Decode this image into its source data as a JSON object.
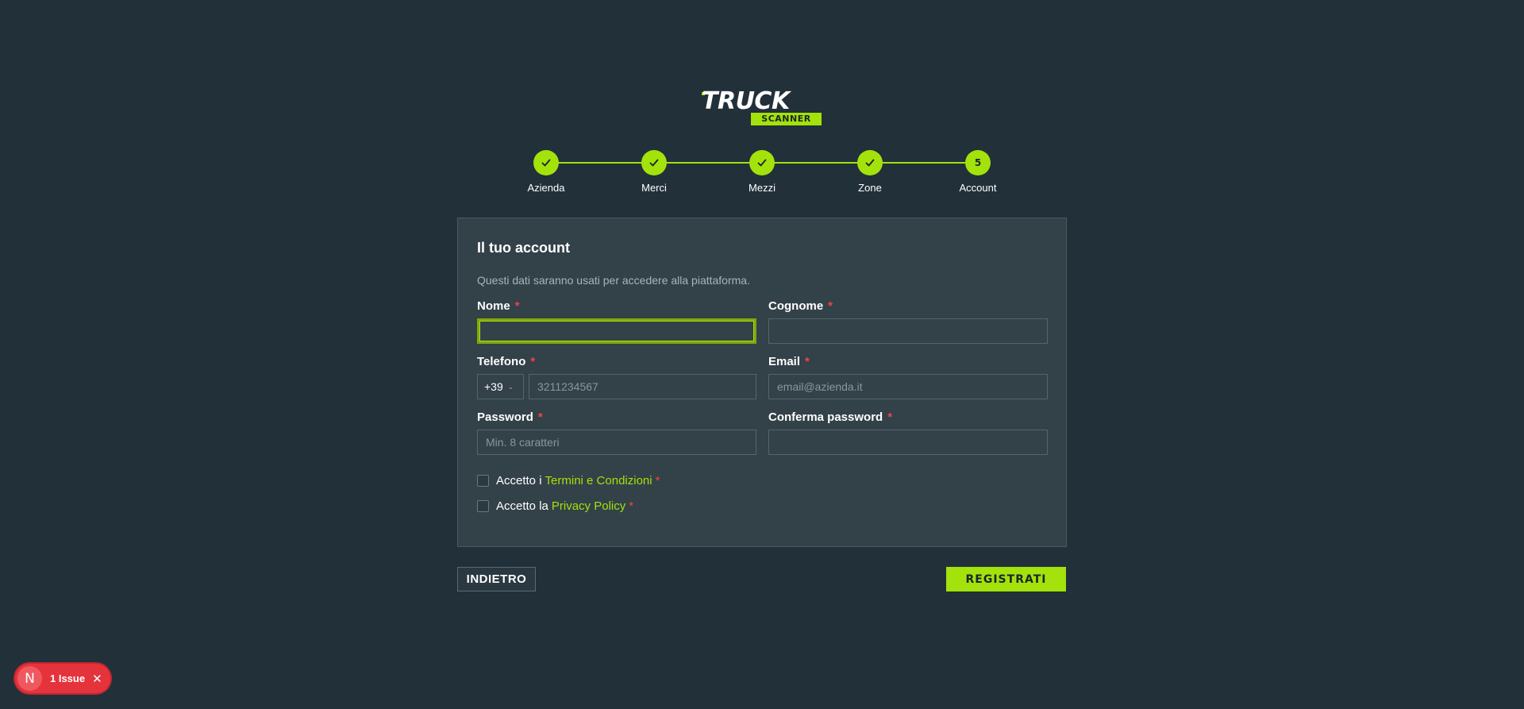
{
  "logo": {
    "word": "TRUCK",
    "sub": "SCANNER"
  },
  "stepper": {
    "current": 5,
    "steps": [
      {
        "label": "Azienda",
        "state": "done"
      },
      {
        "label": "Merci",
        "state": "done"
      },
      {
        "label": "Mezzi",
        "state": "done"
      },
      {
        "label": "Zone",
        "state": "done"
      },
      {
        "label": "Account",
        "state": "current",
        "number": "5"
      }
    ]
  },
  "form": {
    "title": "Il tuo account",
    "description": "Questi dati saranno usati per accedere alla piattaforma.",
    "required_mark": "*",
    "nome": {
      "label": "Nome",
      "value": "",
      "placeholder": ""
    },
    "cognome": {
      "label": "Cognome",
      "value": "",
      "placeholder": ""
    },
    "telefono": {
      "label": "Telefono",
      "prefix": "+39",
      "value": "",
      "placeholder": "3211234567"
    },
    "email": {
      "label": "Email",
      "value": "",
      "placeholder": "email@azienda.it"
    },
    "password": {
      "label": "Password",
      "value": "",
      "placeholder": "Min. 8 caratteri"
    },
    "conferma": {
      "label": "Conferma password",
      "value": "",
      "placeholder": ""
    },
    "terms": {
      "prefix": "Accetto i",
      "link": "Termini e Condizioni",
      "checked": false
    },
    "privacy": {
      "prefix": "Accetto la",
      "link": "Privacy Policy",
      "checked": false
    }
  },
  "buttons": {
    "back": "INDIETRO",
    "register": "REGISTRATI"
  },
  "issue_badge": {
    "avatar": "N",
    "text": "1 Issue"
  },
  "colors": {
    "background": "#22303a",
    "accent": "#a3e20b",
    "card": "#334149",
    "error": "#e5333c"
  }
}
